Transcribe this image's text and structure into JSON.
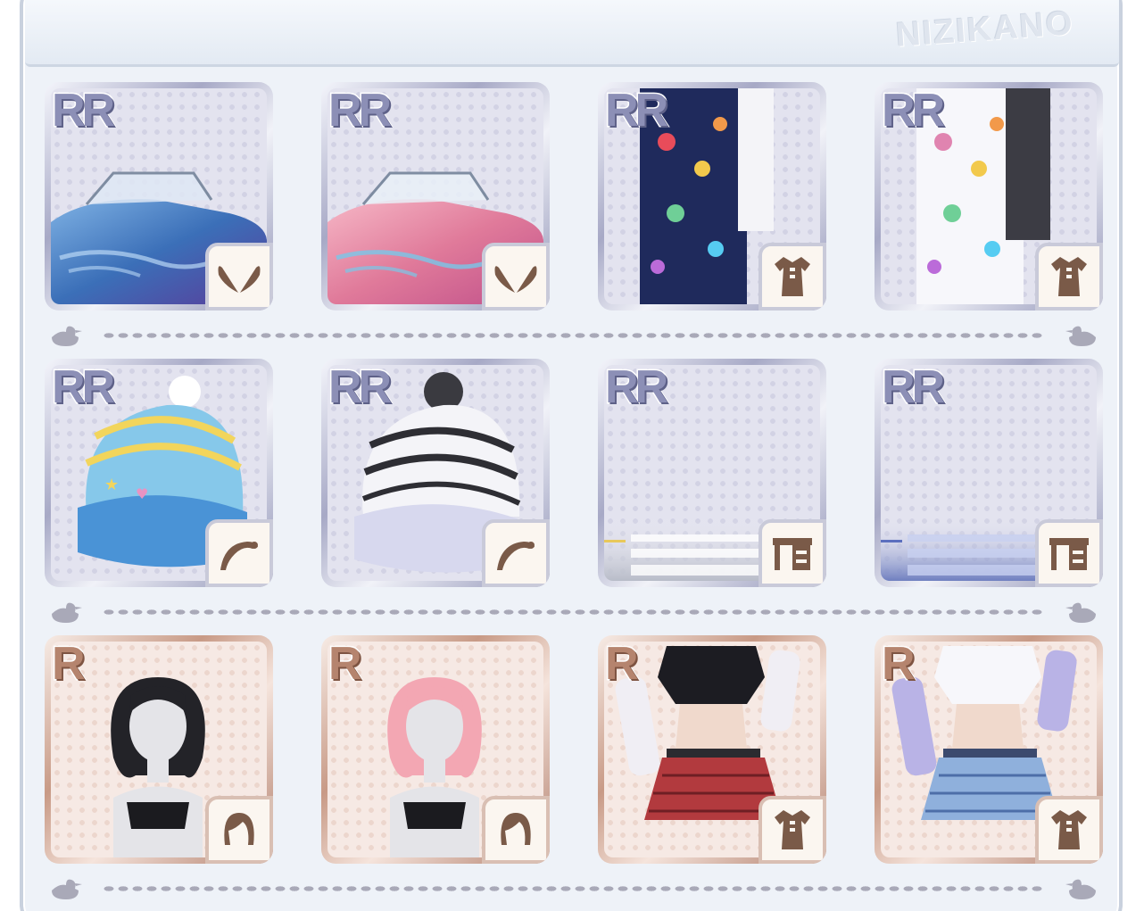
{
  "header": {
    "watermark": "NIZIKANO"
  },
  "colors": {
    "rr_frame": "#a7a9c6",
    "r_frame": "#c89a86",
    "badge_icon": "#7a5a48",
    "divider_dot": "#a9a9b8"
  },
  "rows": [
    {
      "items": [
        {
          "rarity": "RR",
          "category_icon": "wings-icon",
          "art": "blue-convertible-car"
        },
        {
          "rarity": "RR",
          "category_icon": "wings-icon",
          "art": "pink-convertible-car"
        },
        {
          "rarity": "RR",
          "category_icon": "dress-icon",
          "art": "navy-peace-overalls"
        },
        {
          "rarity": "RR",
          "category_icon": "dress-icon",
          "art": "white-peace-overalls"
        }
      ]
    },
    {
      "items": [
        {
          "rarity": "RR",
          "category_icon": "headwear-icon",
          "art": "blue-knit-beanie"
        },
        {
          "rarity": "RR",
          "category_icon": "headwear-icon",
          "art": "white-striped-beanie"
        },
        {
          "rarity": "RR",
          "category_icon": "furniture-icon",
          "art": "gray-crosswalk-background"
        },
        {
          "rarity": "RR",
          "category_icon": "furniture-icon",
          "art": "blue-crosswalk-background"
        }
      ]
    },
    {
      "items": [
        {
          "rarity": "R",
          "category_icon": "hair-icon",
          "art": "black-bob-hair"
        },
        {
          "rarity": "R",
          "category_icon": "hair-icon",
          "art": "pink-bob-hair"
        },
        {
          "rarity": "R",
          "category_icon": "dress-icon",
          "art": "red-plaid-punk-outfit"
        },
        {
          "rarity": "R",
          "category_icon": "dress-icon",
          "art": "blue-plaid-punk-outfit"
        }
      ]
    }
  ]
}
